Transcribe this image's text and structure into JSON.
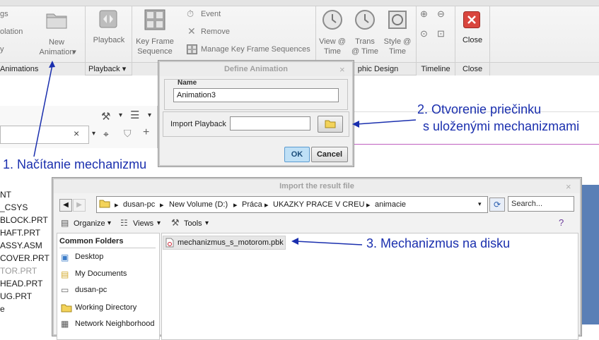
{
  "ribbon": {
    "left_items": [
      "gs",
      "olation",
      "y"
    ],
    "new_animation": "New\nAnimation",
    "new_animation_line1": "New",
    "new_animation_line2": "Animation",
    "playback": "Playback",
    "key_frame_line1": "Key Frame",
    "key_frame_line2": "Sequence",
    "event": "Event",
    "remove": "Remove",
    "manage_kfs": "Manage Key Frame Sequences",
    "view_time_line1": "View @",
    "view_time_line2": "Time",
    "trans_time_line1": "Trans",
    "trans_time_line2": "@ Time",
    "style_time_line1": "Style @",
    "style_time_line2": "Time",
    "close": "Close",
    "groups": {
      "animations": "Animations",
      "playback": "Playback",
      "graphic_design": "phic Design",
      "timeline": "Timeline",
      "close": "Close"
    }
  },
  "tree": {
    "items": [
      "NT",
      "_CSYS",
      "BLOCK.PRT",
      "HAFT.PRT",
      "ASSY.ASM",
      "COVER.PRT",
      "TOR.PRT",
      "HEAD.PRT",
      "UG.PRT",
      "e"
    ]
  },
  "define_dialog": {
    "title": "Define Animation",
    "name_label": "Name",
    "name_value": "Animation3",
    "import_label": "Import Playback",
    "import_value": "",
    "ok": "OK",
    "cancel": "Cancel"
  },
  "import_dialog": {
    "title": "Import the result file",
    "path": [
      "dusan-pc",
      "New Volume (D:)",
      "Práca",
      "UKAZKY PRACE V CREU",
      "animacie"
    ],
    "search_placeholder": "Search...",
    "organize": "Organize",
    "views": "Views",
    "tools": "Tools",
    "common_folders": "Common Folders",
    "folders": [
      "Desktop",
      "My Documents",
      "dusan-pc",
      "Working Directory",
      "Network Neighborhood"
    ],
    "file": "mechanizmus_s_motorom.pbk"
  },
  "annotations": {
    "a1": "1. Načítanie mechanizmu",
    "a2_line1": "2. Otvorenie priečinku",
    "a2_line2": "s uloženými mechanizmami",
    "a3": "3. Mechanizmus na disku"
  },
  "colors": {
    "annotation": "#1a2fae",
    "ok_button": "#bfe0f6"
  }
}
